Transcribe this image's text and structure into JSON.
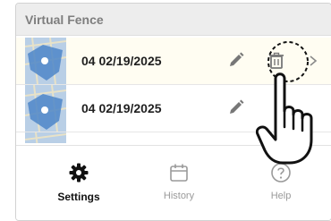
{
  "screen": {
    "section_title": "Virtual Fence",
    "rows": [
      {
        "date": "04 02/19/2025",
        "map_icon": "fence-map-thumbnail",
        "edit_icon": "pencil-icon",
        "delete_icon": "trash-icon",
        "chevron_icon": "chevron-right-icon"
      },
      {
        "date": "04 02/19/2025",
        "map_icon": "fence-map-thumbnail",
        "edit_icon": "pencil-icon"
      }
    ],
    "selected_row": 0
  },
  "tabbar": {
    "active": "settings",
    "tabs": [
      {
        "id": "settings",
        "label": "Settings",
        "icon": "gear-icon"
      },
      {
        "id": "history",
        "label": "History",
        "icon": "calendar-icon"
      },
      {
        "id": "help",
        "label": "Help",
        "icon": "question-icon"
      }
    ]
  },
  "overlay": {
    "highlight": "dashed-circle-highlight",
    "cursor": "hand-pointer-icon"
  },
  "colors": {
    "header_bg": "#ededed",
    "header_text": "#7e7e7e",
    "active_tab": "#111111",
    "inactive_tab": "#9a9a9a",
    "fence_polygon": "#4e86c8",
    "map_bg": "#b9cfe6"
  }
}
